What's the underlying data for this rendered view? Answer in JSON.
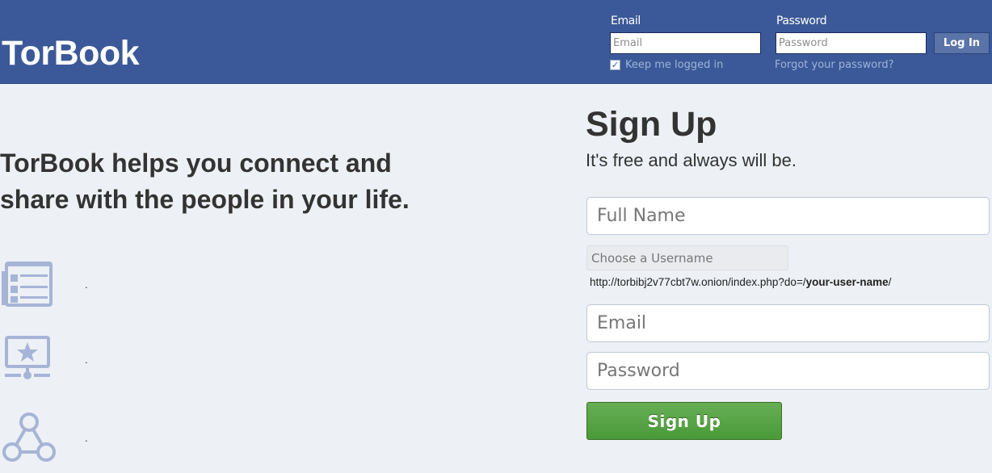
{
  "header": {
    "logo": "TorBook",
    "email_label": "Email",
    "email_placeholder": "Email",
    "password_label": "Password",
    "password_placeholder": "Password",
    "login_button": "Log In",
    "keep_logged_in": "Keep me logged in",
    "keep_logged_in_checked": true,
    "forgot_password": "Forgot your password?"
  },
  "pitch": {
    "headline": "TorBook helps you connect and share with the people in your life.",
    "features": [
      {
        "icon": "news-feed-icon",
        "text": "."
      },
      {
        "icon": "starred-screen-icon",
        "text": "."
      },
      {
        "icon": "network-icon",
        "text": "."
      }
    ]
  },
  "signup": {
    "title": "Sign Up",
    "subtitle": "It's free and always will be.",
    "full_name_placeholder": "Full Name",
    "username_placeholder": "Choose a Username",
    "url_prefix": "http://torbibj2v77cbt7w.onion/index.php?do=/",
    "url_username": "your-user-name",
    "url_suffix": "/",
    "email_placeholder": "Email",
    "password_placeholder": "Password",
    "signup_button": "Sign Up"
  },
  "colors": {
    "header_bg": "#3b5998",
    "page_bg": "#edf0f5",
    "signup_button": "#5aa545",
    "icon_color": "#a6b4d6"
  }
}
